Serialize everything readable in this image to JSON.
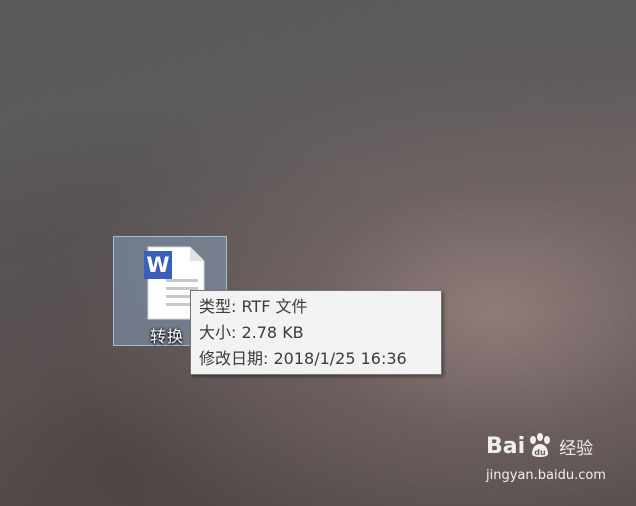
{
  "desktop": {
    "file_icon": {
      "icon_name": "wps-word-document-icon",
      "badge_letter": "W",
      "label": "转换",
      "badge_color": "#3a5fb8"
    }
  },
  "tooltip": {
    "type_line": "类型: RTF 文件",
    "size_line": "大小: 2.78 KB",
    "modified_line": "修改日期: 2018/1/25 16:36"
  },
  "watermark": {
    "brand_left": "Bai",
    "brand_right": "经验",
    "url": "jingyan.baidu.com"
  }
}
